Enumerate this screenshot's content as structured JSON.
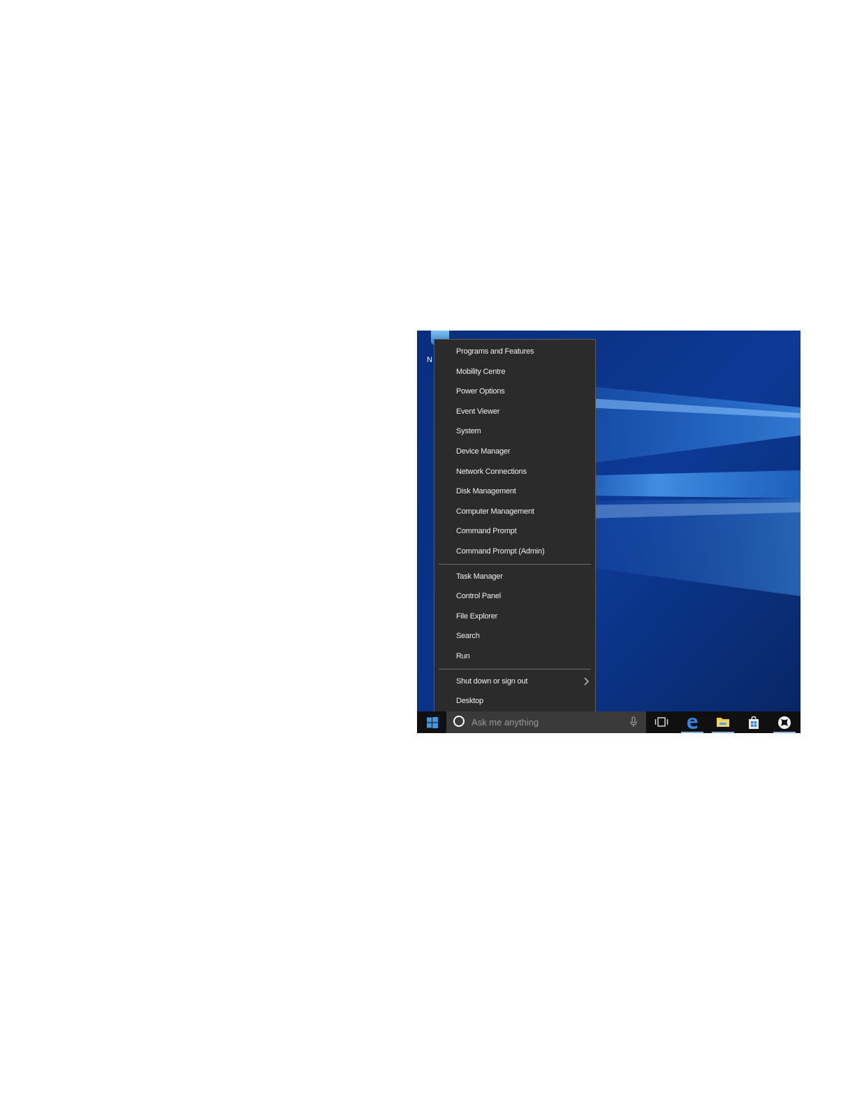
{
  "desktop": {
    "icon_label": "N"
  },
  "menu": {
    "group1": [
      "Programs and Features",
      "Mobility Centre",
      "Power Options",
      "Event Viewer",
      "System",
      "Device Manager",
      "Network Connections",
      "Disk Management",
      "Computer Management",
      "Command Prompt",
      "Command Prompt (Admin)"
    ],
    "group2": [
      "Task Manager",
      "Control Panel",
      "File Explorer",
      "Search",
      "Run"
    ],
    "group3": [
      "Shut down or sign out",
      "Desktop"
    ]
  },
  "taskbar": {
    "search_placeholder": "Ask me anything",
    "icons": [
      "windows-logo-icon",
      "cortana-circle-icon",
      "microphone-icon",
      "task-view-icon",
      "edge-icon",
      "file-explorer-icon",
      "store-icon",
      "xbox-icon"
    ]
  },
  "colors": {
    "menu_bg": "#2b2b2b",
    "menu_text": "#f1f1f1",
    "taskbar_bg": "#101010",
    "search_bg": "#3a3a3a",
    "wallpaper_blue": "#0b2f78",
    "accent": "#1f8ad2"
  }
}
